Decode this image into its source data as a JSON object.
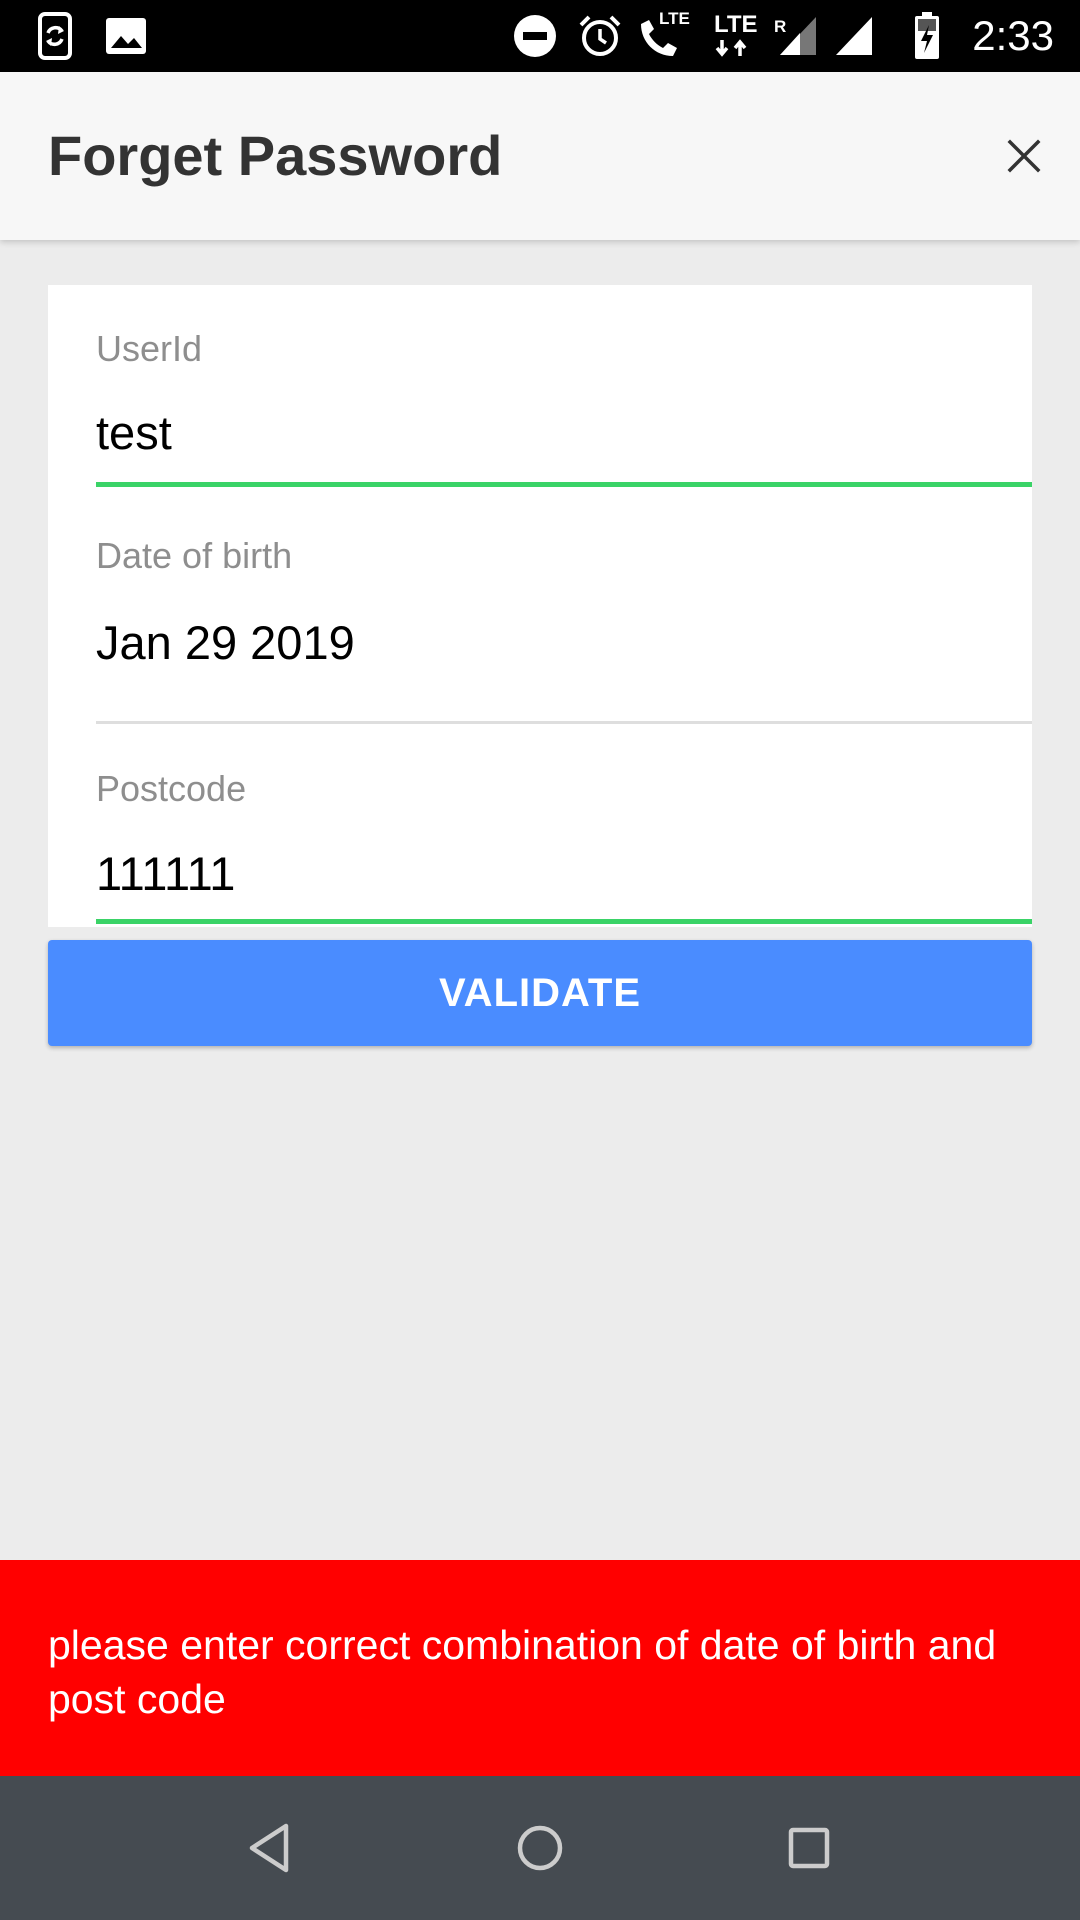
{
  "status_bar": {
    "time": "2:33",
    "icons": [
      "screen-rotate-icon",
      "image-icon",
      "do-not-disturb-icon",
      "alarm-icon",
      "lte-call-icon",
      "lte-data-icon",
      "signal-roaming-icon",
      "signal-icon",
      "battery-charging-icon"
    ],
    "lte_call_label": "LTE",
    "lte_data_label": "LTE",
    "roaming_label": "R"
  },
  "header": {
    "title": "Forget Password",
    "close_icon": "close-icon"
  },
  "form": {
    "userid": {
      "label": "UserId",
      "value": "test"
    },
    "dob": {
      "label": "Date of birth",
      "value": "Jan 29 2019"
    },
    "postcode": {
      "label": "Postcode",
      "value": "111111"
    }
  },
  "validate_button": {
    "label": "VALIDATE"
  },
  "error": {
    "message": "please enter correct combination of date of birth and post code"
  },
  "nav_bar": {
    "icons": [
      "back-icon",
      "home-icon",
      "recents-icon"
    ]
  },
  "colors": {
    "accent_button": "#4a8cff",
    "field_active_underline": "#3ad367",
    "error_background": "#ff0000",
    "status_bar": "#000000",
    "nav_bar": "#454b51"
  }
}
